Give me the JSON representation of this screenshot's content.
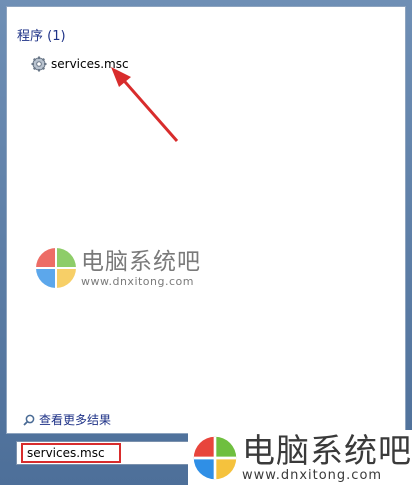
{
  "results": {
    "group_title": "程序 (1)",
    "items": [
      {
        "label": "services.msc",
        "icon": "services-gear-icon"
      }
    ]
  },
  "watermark": {
    "title": "电脑系统吧",
    "url": "www.dnxitong.com"
  },
  "see_more": {
    "label": "查看更多结果",
    "icon": "magnifier-icon"
  },
  "search": {
    "value": "services.msc"
  },
  "colors": {
    "annotation_red": "#d82c2c",
    "group_title_blue": "#1e3287",
    "logo_red": "#e8453c",
    "logo_green": "#6fbf3f",
    "logo_blue": "#2f8fe6",
    "logo_yellow": "#f5c23d"
  }
}
